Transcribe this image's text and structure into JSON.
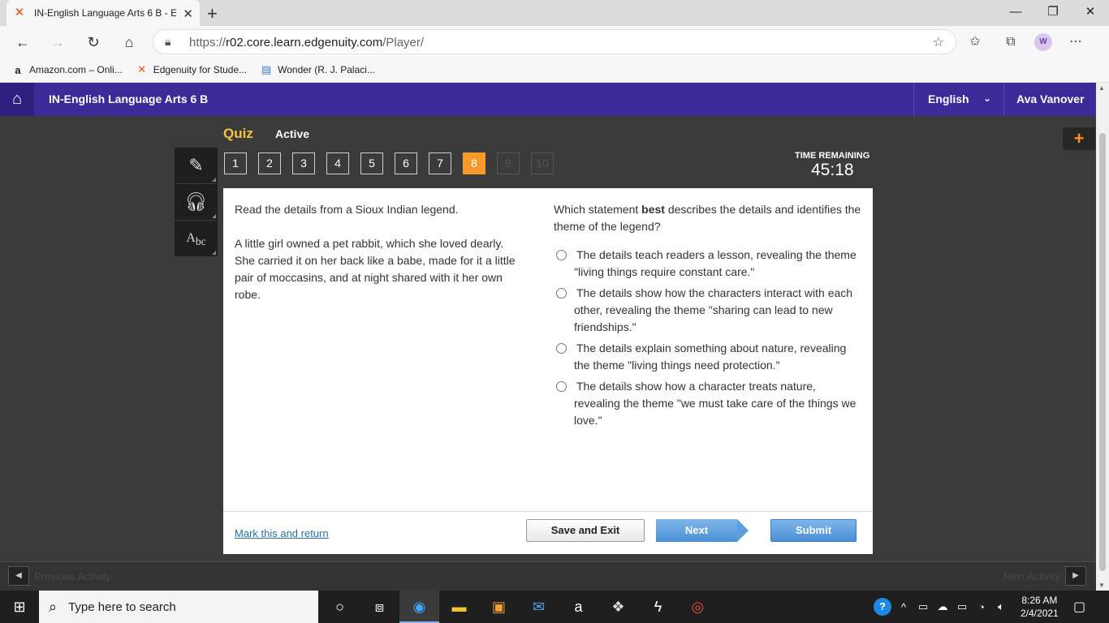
{
  "browser": {
    "tab_title": "IN-English Language Arts 6 B - E",
    "tab_favicon": "edgenuity-x-icon",
    "url_prefix": "https://",
    "url_host": "r02.core.learn.edgenuity.com",
    "url_path": "/Player/",
    "profile_initial": "W",
    "bookmarks": [
      {
        "icon": "a",
        "label": "Amazon.com – Onli..."
      },
      {
        "icon": "✕",
        "label": "Edgenuity for Stude..."
      },
      {
        "icon": "▤",
        "label": "Wonder (R. J. Palaci..."
      }
    ]
  },
  "header": {
    "course_title": "IN-English Language Arts 6 B",
    "language": "English",
    "user_name": "Ava Vanover"
  },
  "quiz": {
    "label": "Quiz",
    "status": "Active",
    "question_numbers": [
      "1",
      "2",
      "3",
      "4",
      "5",
      "6",
      "7",
      "8",
      "9",
      "10"
    ],
    "current_question": 8,
    "time_remaining_label": "TIME REMAINING",
    "time_remaining": "45:18"
  },
  "passage": {
    "intro": "Read the details from a Sioux Indian legend.",
    "text": "A little girl owned a pet rabbit, which she loved dearly. She carried it on her back like a babe, made for it a little pair of moccasins, and at night shared with it her own robe."
  },
  "question": {
    "stem_before": "Which statement ",
    "stem_bold": "best",
    "stem_after": " describes the details and identifies the theme of the legend?",
    "options": [
      "The details teach readers a lesson, revealing the theme \"living things require constant care.\"",
      "The details show how the characters interact with each other, revealing the theme \"sharing can lead to new friendships.\"",
      "The details explain something about nature, revealing the theme \"living things need protection.\"",
      "The details show how a character treats nature, revealing the theme \"we must take care of the things we love.\""
    ]
  },
  "footer": {
    "mark_return": "Mark this and return",
    "save_exit": "Save and Exit",
    "next": "Next",
    "submit": "Submit"
  },
  "activity_nav": {
    "previous": "Previous Activity",
    "next": "Next Activity"
  },
  "taskbar": {
    "search_placeholder": "Type here to search",
    "time": "8:26 AM",
    "date": "2/4/2021"
  },
  "colors": {
    "header_purple": "#3c2a98",
    "accent_orange": "#f79a2d",
    "quiz_yellow": "#f7c142",
    "button_blue": "#4a8fd6"
  }
}
